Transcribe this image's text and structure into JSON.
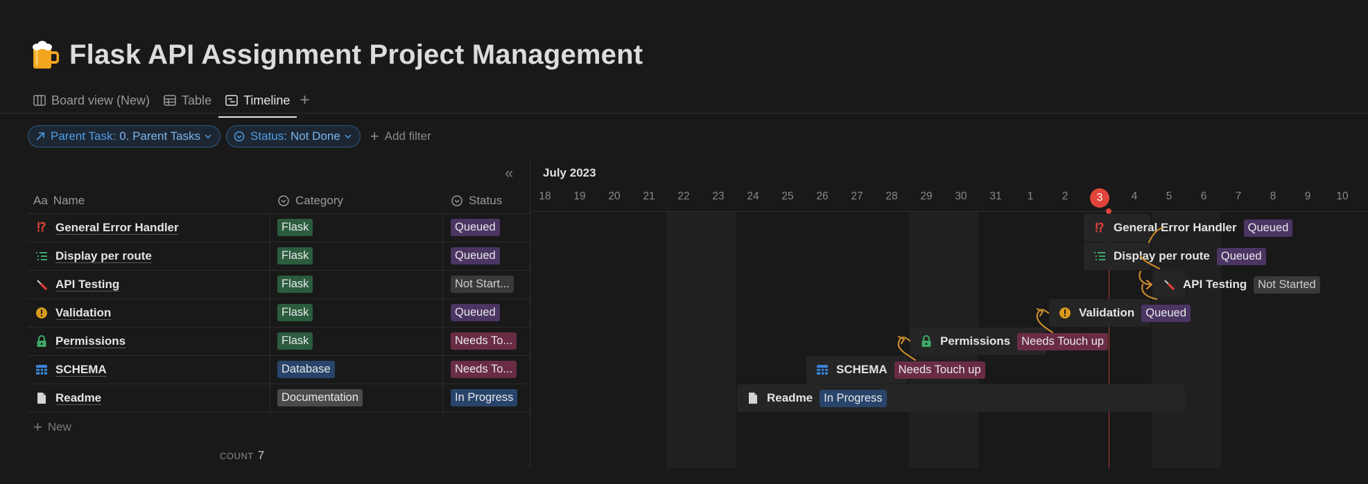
{
  "page": {
    "title": "Flask API Assignment Project Management",
    "icon": "beer-mug-icon"
  },
  "tabs": [
    {
      "label": "Board view (New)",
      "icon": "board-icon",
      "active": false
    },
    {
      "label": "Table",
      "icon": "table-icon",
      "active": false
    },
    {
      "label": "Timeline",
      "icon": "timeline-icon",
      "active": true
    }
  ],
  "filters": [
    {
      "prop": "Parent Task:",
      "value": "0. Parent Tasks",
      "icon": "relation-arrow-icon"
    },
    {
      "prop": "Status:",
      "value": "Not Done",
      "icon": "status-icon"
    }
  ],
  "add_filter_label": "Add filter",
  "table": {
    "headers": {
      "name": "Name",
      "name_icon": "Aa",
      "category": "Category",
      "status": "Status"
    },
    "rows": [
      {
        "name": "General Error Handler",
        "icon": "interrobang-icon",
        "category": "Flask",
        "category_color": "#2b5c3e",
        "status": "Queued",
        "status_color": "#4a3563"
      },
      {
        "name": "Display per route",
        "icon": "list-icon",
        "category": "Flask",
        "category_color": "#2b5c3e",
        "status": "Queued",
        "status_color": "#4a3563"
      },
      {
        "name": "API Testing",
        "icon": "screwdriver-icon",
        "category": "Flask",
        "category_color": "#2b5c3e",
        "status": "Not Start...",
        "status_color": "#3a3a3a"
      },
      {
        "name": "Validation",
        "icon": "warning-circle-icon",
        "category": "Flask",
        "category_color": "#2b5c3e",
        "status": "Queued",
        "status_color": "#4a3563"
      },
      {
        "name": "Permissions",
        "icon": "lock-icon",
        "category": "Flask",
        "category_color": "#2b5c3e",
        "status": "Needs To...",
        "status_color": "#6a2c45"
      },
      {
        "name": "SCHEMA",
        "icon": "table-grid-icon",
        "category": "Database",
        "category_color": "#28446b",
        "status": "Needs To...",
        "status_color": "#6a2c45"
      },
      {
        "name": "Readme",
        "icon": "document-icon",
        "category": "Documentation",
        "category_color": "#4a4a4a",
        "status": "In Progress",
        "status_color": "#28446b"
      }
    ],
    "new_label": "New",
    "count_label": "COUNT",
    "count_value": "7"
  },
  "timeline": {
    "month": "July 2023",
    "days": [
      "18",
      "19",
      "20",
      "21",
      "22",
      "23",
      "24",
      "25",
      "26",
      "27",
      "28",
      "29",
      "30",
      "31",
      "1",
      "2",
      "3",
      "4",
      "5",
      "6",
      "7",
      "8",
      "9",
      "10"
    ],
    "today": "3",
    "items": [
      {
        "name": "General Error Handler",
        "status": "Queued"
      },
      {
        "name": "Display per route",
        "status": "Queued"
      },
      {
        "name": "API Testing",
        "status": "Not Started"
      },
      {
        "name": "Validation",
        "status": "Queued"
      },
      {
        "name": "Permissions",
        "status": "Needs Touch up"
      },
      {
        "name": "SCHEMA",
        "status": "Needs Touch up"
      },
      {
        "name": "Readme",
        "status": "In Progress"
      }
    ]
  },
  "colors": {
    "background": "#191919",
    "accent_blue": "#4f9fe8",
    "today_red": "#e0443a",
    "dependency_arrow": "#c98a2b"
  }
}
